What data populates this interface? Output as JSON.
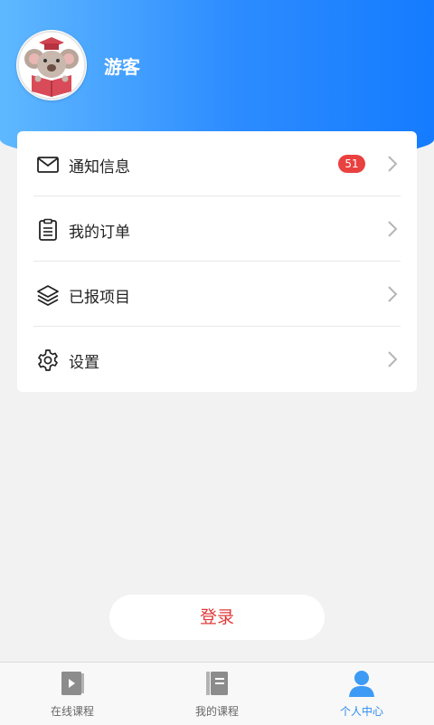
{
  "profile": {
    "username": "游客",
    "avatar_icon": "koala-avatar-icon"
  },
  "menu": {
    "items": [
      {
        "label": "通知信息",
        "icon": "mail-icon",
        "badge": "51"
      },
      {
        "label": "我的订单",
        "icon": "clipboard-icon"
      },
      {
        "label": "已报项目",
        "icon": "layers-icon"
      },
      {
        "label": "设置",
        "icon": "gear-icon"
      }
    ]
  },
  "login_button": {
    "label": "登录"
  },
  "tabbar": {
    "tabs": [
      {
        "label": "在线课程",
        "icon": "play-book-icon",
        "active": false
      },
      {
        "label": "我的课程",
        "icon": "notebook-icon",
        "active": false
      },
      {
        "label": "个人中心",
        "icon": "person-icon",
        "active": true
      }
    ]
  },
  "colors": {
    "accent": "#2d8cf0",
    "badge": "#e9413f",
    "login_text": "#e03a3a"
  }
}
